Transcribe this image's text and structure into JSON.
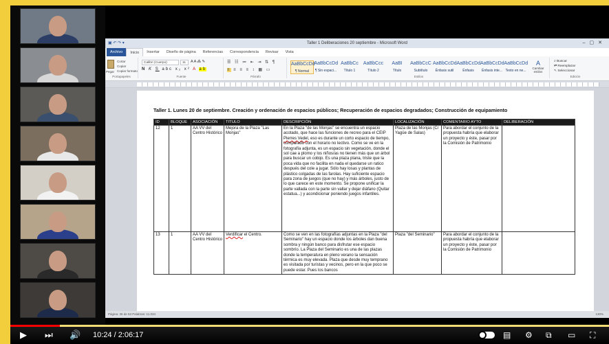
{
  "player": {
    "time_current": "10:24",
    "time_separator": " / ",
    "time_total": "2:06:17",
    "progress_fraction": 0.0824,
    "accent_color": "#ff0000"
  },
  "participants": [
    {
      "bg": "#6f7a86",
      "shirt": "#2c3e66"
    },
    {
      "bg": "#8a8d92",
      "shirt": "#d8d8d8"
    },
    {
      "bg": "#5c5a56",
      "shirt": "#3a4e6e"
    },
    {
      "bg": "#7c6e5e",
      "shirt": "#e8e8e8"
    },
    {
      "bg": "#d4cfc6",
      "shirt": "#f2f2f2"
    },
    {
      "bg": "#b6a48a",
      "shirt": "#2b3f8a"
    },
    {
      "bg": "#4e4a46",
      "shirt": "#2a2a2a"
    },
    {
      "bg": "#3d3a38",
      "shirt": "#1e2a4a"
    }
  ],
  "word": {
    "window_title": "Taller 1 Deliberaciones 20 septiembre - Microsoft Word",
    "tabs": [
      "Archivo",
      "Inicio",
      "Insertar",
      "Diseño de página",
      "Referencias",
      "Correspondencia",
      "Revisar",
      "Vista"
    ],
    "font_name": "Calibri (Cuerpo)",
    "font_size": "11",
    "group_labels": [
      "Portapapeles",
      "Fuente",
      "Párrafo",
      "Estilos",
      "Edición"
    ],
    "clipboard": [
      "Cortar",
      "Copiar",
      "Copiar formato",
      "Pegar"
    ],
    "styles": [
      {
        "sample": "AaBbCcDd",
        "name": "¶ Normal"
      },
      {
        "sample": "AaBbCcDd",
        "name": "¶ Sin espaci..."
      },
      {
        "sample": "AaBbCc",
        "name": "Título 1"
      },
      {
        "sample": "AaBbCcc",
        "name": "Título 2"
      },
      {
        "sample": "AaBI",
        "name": "Título"
      },
      {
        "sample": "AaBbCcC",
        "name": "Subtítulo"
      },
      {
        "sample": "AaBbCcDd",
        "name": "Énfasis sutil"
      },
      {
        "sample": "AaBbCcDd",
        "name": "Énfasis"
      },
      {
        "sample": "AaBbCcDd",
        "name": "Énfasis inte..."
      },
      {
        "sample": "AaBbCcDd",
        "name": "Texto en ne..."
      }
    ],
    "change_styles": "Cambiar estilos",
    "editing": [
      "Buscar",
      "Reemplazar",
      "Seleccionar"
    ],
    "status": "Página: 36 de 53   Palabras: 11.034",
    "zoom": "130%",
    "doc_title": "Taller 1. Lunes 20 de septiembre. Creación y ordenación de espacios públicos; Recuperación de espacios degradados; Construcción de equipamiento",
    "table": {
      "headers": [
        "ID",
        "BLOQUE",
        "ASOCIACIÓN",
        "TITULO",
        "DESCRIPCIÓN",
        "LOCALIZACIÓN",
        "COMENTARIO AYTO",
        "DELIBERACIÓN"
      ],
      "rows": [
        {
          "id": "12",
          "bloque": "1",
          "asociacion": "AA VV del Centro Histórico",
          "titulo": "Mejora de la Plaza \"Las Monjas\"",
          "descripcion_a": "En la Plaza \"de las Monjas\" se encuentra un espacio acotado, que hace las funciones de recreo para el CEIP ",
          "descripcion_u": "Pierres Vedel",
          "descripcion_b": ", eso es durante un corto espacio de tiempo, comparado con el horario no lectivo. Como se ve en la fotografía adjunta, es un espacio sin vegetación, donde el sol cae a plomo y los niños/as no tienen más que un árbol para buscar un cobijo. Es una plaza plana, triste que la poca vida que no facilita en nada el quedarse un ratico después del cole a jugar. Sólo hay losas y plantas de plástico colgadas de las farolas. Hay suficiente espacio para zona de juegos (que no hay) y más árboles, justo de lo que carece en este momento. Se propone unificar la parte vallada con la parte sin vallar y dejar diáfano (Quitar estatua...) y acondicionar poniendo juegos infantiles.",
          "localizacion": "Plaza de las Monjas (C/ Yagüe de Salas)",
          "comentario": "Para abordar el conjunto de la propuesta habría que elaborar un proyecto y éste, pasar por la Comisión de Patrimonio",
          "deliberacion": ""
        },
        {
          "id": "13",
          "bloque": "1",
          "asociacion": "AA VV del Centro Histórico",
          "titulo_u": "Verdificar",
          "titulo_b": " el Centro.",
          "descripcion": "Como se ven en las fotografías adjuntas en la Plaza \"del Seminario\" hay un espacio donde los árboles dan buena sombra y ningún banco para disfrutar ese espacio sombrío. La Plaza del Seminario es una de las plazas donde la temperatura en pleno verano la sensación térmica es muy elevada. Plaza que desde muy temprano es visitada por turistas y vecinos, pero en la que poco se puede estar. Pues los bancos",
          "localizacion": "Plaza \"del Seminario\"",
          "comentario": "Para abordar el conjunto de la propuesta habría que elaborar un proyecto y éste, pasar por la Comisión de Patrimonio",
          "deliberacion": ""
        }
      ]
    }
  }
}
